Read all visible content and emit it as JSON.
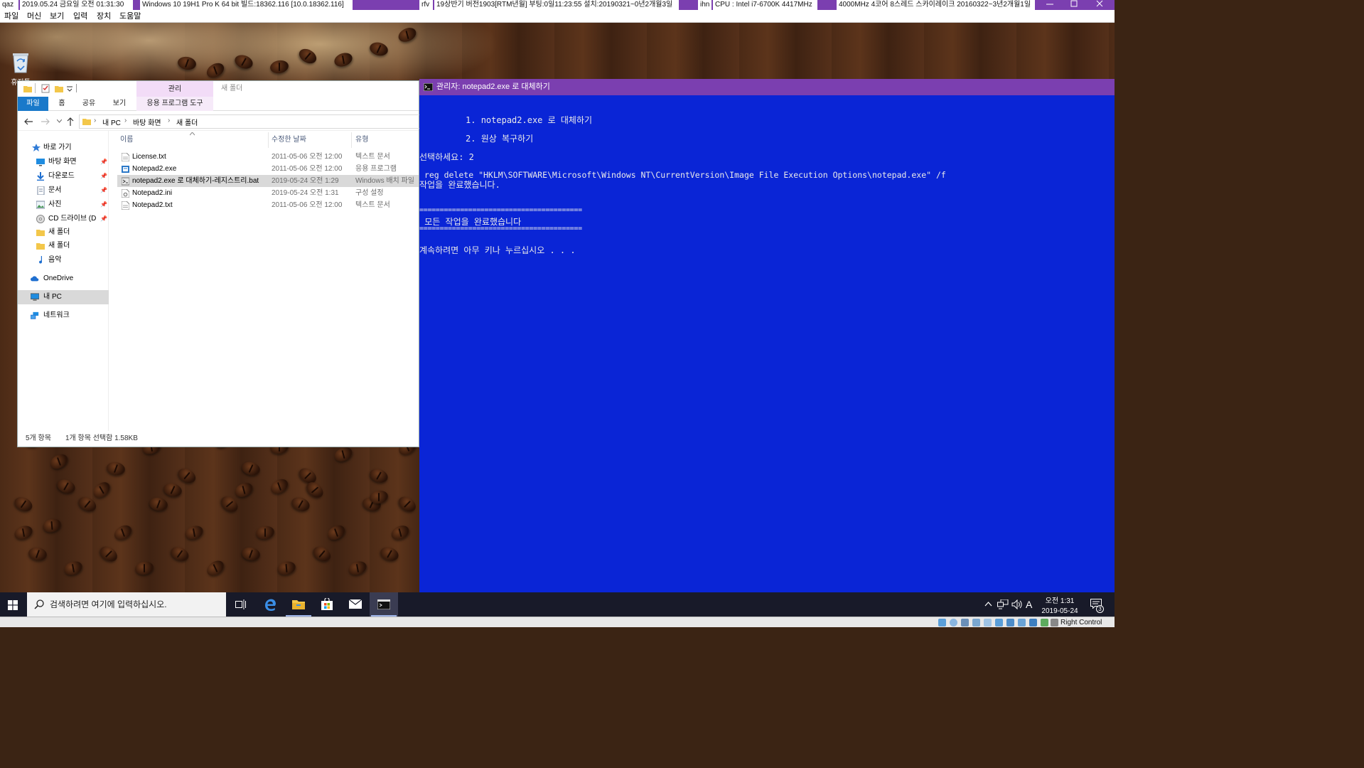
{
  "vm": {
    "info_chips": [
      "qaz",
      "2019.05.24 금요일 오전 01:31:30",
      "Windows 10 19H1 Pro K 64 bit 빌드:18362.116 [10.0.18362.116]",
      "rfv",
      "19상반기 버전1903[RTM년월] 부팅:0일11:23:55 설치:20190321~0년2개월3일",
      "ihn",
      "CPU : Intel i7-6700K 4417MHz",
      "4000MHz 4코어 8스레드 스카이레이크 20160322~3년2개월1일"
    ],
    "menu": [
      "파일",
      "머신",
      "보기",
      "입력",
      "장치",
      "도움말"
    ],
    "host_key": "Right Control"
  },
  "desktop": {
    "recycle_bin_label": "휴지통"
  },
  "explorer": {
    "context_tab_label": "관리",
    "window_title": "새 폴더",
    "ribbon_tabs": [
      "파일",
      "홈",
      "공유",
      "보기",
      "응용 프로그램 도구"
    ],
    "breadcrumb": [
      "내 PC",
      "바탕 화면",
      "새 폴더"
    ],
    "nav_items": [
      {
        "label": "바로 가기",
        "icon": "star-icon"
      },
      {
        "label": "바탕 화면",
        "icon": "desktop-icon",
        "pinned": true
      },
      {
        "label": "다운로드",
        "icon": "download-icon",
        "pinned": true
      },
      {
        "label": "문서",
        "icon": "documents-icon",
        "pinned": true
      },
      {
        "label": "사진",
        "icon": "pictures-icon",
        "pinned": true
      },
      {
        "label": "CD 드라이브 (D",
        "icon": "cd-drive-icon",
        "pinned": true
      },
      {
        "label": "새 폴더",
        "icon": "folder-icon"
      },
      {
        "label": "새 폴더",
        "icon": "folder-icon"
      },
      {
        "label": "음악",
        "icon": "music-icon"
      },
      {
        "label": "OneDrive",
        "icon": "onedrive-icon"
      },
      {
        "label": "내 PC",
        "icon": "pc-icon",
        "selected": true
      },
      {
        "label": "네트워크",
        "icon": "network-icon"
      }
    ],
    "columns": [
      "이름",
      "수정한 날짜",
      "유형"
    ],
    "files": [
      {
        "name": "License.txt",
        "date": "2011-05-06 오전 12:00",
        "type": "텍스트 문서",
        "icon": "text-file-icon"
      },
      {
        "name": "Notepad2.exe",
        "date": "2011-05-06 오전 12:00",
        "type": "응용 프로그램",
        "icon": "exe-file-icon"
      },
      {
        "name": "notepad2.exe 로 대체하기-레지스트리.bat",
        "date": "2019-05-24 오전 1:29",
        "type": "Windows 배치 파일",
        "icon": "bat-file-icon",
        "selected": true
      },
      {
        "name": "Notepad2.ini",
        "date": "2019-05-24 오전 1:31",
        "type": "구성 설정",
        "icon": "ini-file-icon"
      },
      {
        "name": "Notepad2.txt",
        "date": "2011-05-06 오전 12:00",
        "type": "텍스트 문서",
        "icon": "text-file-icon"
      }
    ],
    "status_count": "5개 항목",
    "status_selection": "1개 항목 선택함 1.58KB"
  },
  "console": {
    "title": "관리자:  notepad2.exe 로 대체하기",
    "lines": [
      "         1. notepad2.exe 로 대체하기",
      "         2. 원상 복구하기",
      "선택하세요: 2",
      " reg delete \"HKLM\\SOFTWARE\\Microsoft\\Windows NT\\CurrentVersion\\Image File Execution Options\\notepad.exe\" /f",
      "작업을 완료했습니다.",
      "========================================",
      " 모든 작업을 완료했습니다",
      "========================================",
      "계속하려면 아무 키나 누르십시오 . . ."
    ]
  },
  "taskbar": {
    "search_placeholder": "검색하려면 여기에 입력하십시오.",
    "ime_indicator": "A",
    "clock_time": "오전 1:31",
    "clock_date": "2019-05-24",
    "notification_count": "3"
  },
  "colors": {
    "vm_accent": "#7b3fb0",
    "console_bg": "#0a25d6",
    "taskbar_bg": "#181a29",
    "ribbon_file_tab": "#1979ca",
    "context_tab_bg": "#f2dcf7"
  }
}
